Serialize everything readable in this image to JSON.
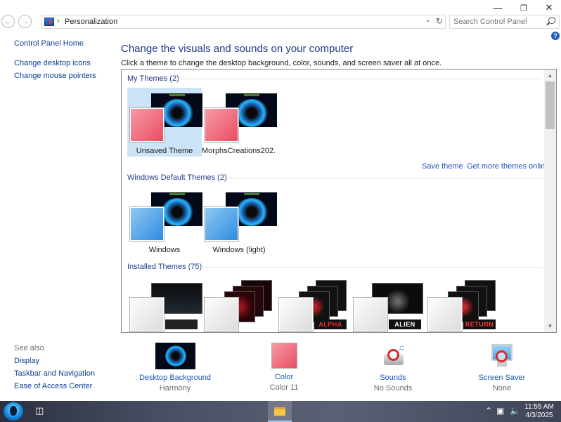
{
  "window": {
    "title_buttons": [
      "—",
      "❐",
      "✕"
    ],
    "breadcrumb": "Personalization",
    "search_placeholder": "Search Control Panel"
  },
  "nav": {
    "back_icon": "back-arrow-icon",
    "forward_icon": "forward-arrow-icon"
  },
  "sidebar": {
    "links": [
      "Control Panel Home",
      "Change desktop icons",
      "Change mouse pointers"
    ],
    "see_also_label": "See also",
    "see_also": [
      "Display",
      "Taskbar and Navigation",
      "Ease of Access Center"
    ]
  },
  "main": {
    "heading": "Change the visuals and sounds on your computer",
    "subtitle": "Click a theme to change the desktop background, color, sounds, and screen saver all at once.",
    "groups": {
      "my_themes": "My Themes (2)",
      "windows_default": "Windows Default Themes (2)",
      "installed": "Installed Themes (75)"
    },
    "my_themes": [
      "Unsaved Theme",
      "MorphsCreations202..."
    ],
    "windows_themes": [
      "Windows",
      "Windows (light)"
    ],
    "installed_brands": [
      "",
      "",
      "ALPHA",
      "ALIEN",
      "RETURN"
    ],
    "save_theme": "Save theme",
    "get_more": "Get more themes online"
  },
  "bottom": {
    "items": [
      {
        "title": "Desktop Background",
        "value": "Harmony"
      },
      {
        "title": "Color",
        "value": "Color 11"
      },
      {
        "title": "Sounds",
        "value": "No Sounds"
      },
      {
        "title": "Screen Saver",
        "value": "None"
      }
    ]
  },
  "taskbar": {
    "time": "11:55 AM",
    "date": "4/3/2025"
  },
  "colors": {
    "link": "#1a56b8",
    "heading": "#1e3a8a",
    "selected": "#cce4f7",
    "accent_pink": "#e84d62"
  }
}
